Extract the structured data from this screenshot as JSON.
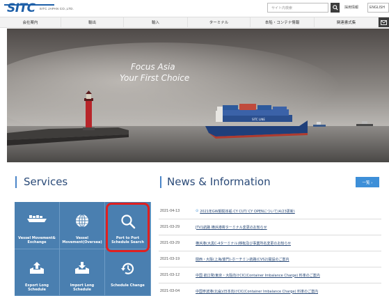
{
  "header": {
    "logo_text": "SITC",
    "logo_sub": "SITC JAPAN CO.,LTD.",
    "search_placeholder": "サイト内検索",
    "recruit_label": "採用情報",
    "lang_label": "ENGLISH"
  },
  "nav": {
    "items": [
      {
        "label": "会社案内"
      },
      {
        "label": "輸出"
      },
      {
        "label": "輸入"
      },
      {
        "label": "ターミナル"
      },
      {
        "label": "本船・コンテナ情報"
      },
      {
        "label": "関連書式集"
      }
    ]
  },
  "hero": {
    "title": "Focus Asia",
    "subtitle": "Your First Choice",
    "ship_text": "SITC LINE"
  },
  "services": {
    "title": "Services",
    "tiles": [
      {
        "label_line1": "Vessel Movement&",
        "label_line2": "Exchange",
        "icon": "ship-icon"
      },
      {
        "label_line1": "Vessel",
        "label_line2": "Movement(Oversea)",
        "icon": "globe-icon"
      },
      {
        "label_line1": "Port to Port",
        "label_line2": "Schedule Search",
        "icon": "search-icon"
      },
      {
        "label_line1": "Export Long",
        "label_line2": "Schedule",
        "icon": "export-icon"
      },
      {
        "label_line1": "Import Long",
        "label_line2": "Schedule",
        "icon": "import-icon"
      },
      {
        "label_line1": "Schedule Change",
        "label_line2": "",
        "icon": "history-icon"
      }
    ]
  },
  "news": {
    "title": "News & Information",
    "all_button": "一覧 ›",
    "items": [
      {
        "date": "2021-04-13",
        "text": "2021年GW期間本船 CY CUT/ CY OPENについて(4/23更新)",
        "icon": "⊙"
      },
      {
        "date": "2021-03-29",
        "text": "JTV1航路 横浜港寄ターミナル変更のお知らせ",
        "icon": ""
      },
      {
        "date": "2021-03-29",
        "text": "横浜港(大黒C-4ターミナル)移転及び事業所名変更のお知らせ",
        "icon": ""
      },
      {
        "date": "2021-03-19",
        "text": "関西・大阪(上海/廈門)-ホーチミン航路(CVS2)開設のご案内",
        "icon": ""
      },
      {
        "date": "2021-03-12",
        "text": "中国 航口発/東京・大阪向けCIC(Container Imbalance Charge) 料率のご案内",
        "icon": ""
      },
      {
        "date": "2021-03-04",
        "text": "中国寧波港(北侖)/日本向けCIC(Container Imbalance Charge) 料率のご案内",
        "icon": ""
      }
    ]
  },
  "colors": {
    "brand": "#1d5fa8",
    "tile": "#4a7fb0",
    "highlight": "#e02020",
    "accent_button": "#3d8fd8"
  }
}
